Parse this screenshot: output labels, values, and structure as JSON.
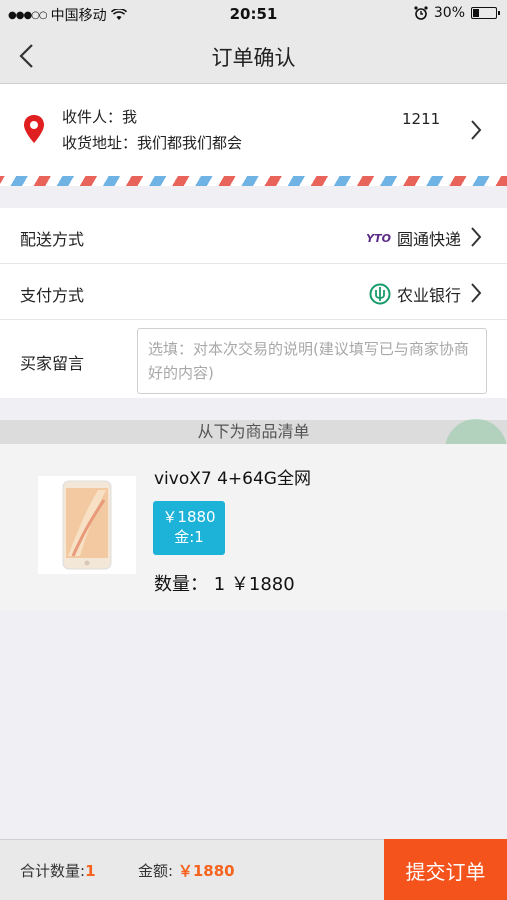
{
  "status": {
    "carrier": "中国移动",
    "time": "20:51",
    "battery": "30%",
    "battery_level": 0.3
  },
  "nav": {
    "title": "订单确认"
  },
  "address": {
    "name_label": "收件人：我",
    "addr_label": "收货地址：我们都我们都会",
    "phone": "1211"
  },
  "shipping": {
    "label": "配送方式",
    "value": "圆通快递",
    "logo_text": "YTO"
  },
  "payment": {
    "label": "支付方式",
    "value": "农业银行"
  },
  "message": {
    "label": "买家留言",
    "placeholder": "选填：对本次交易的说明(建议填写已与商家协商好的内容)"
  },
  "goods_header": "从下为商品清单",
  "product": {
    "name": "vivoX7 4+64G全网",
    "price": "￥1880",
    "gold": "金:1",
    "quantity": "数量：  1    ￥1880"
  },
  "footer": {
    "count_label": "合计数量:",
    "count": "1",
    "amount_label": "金额:",
    "amount": "￥1880",
    "submit": "提交订单"
  },
  "colors": {
    "accent": "#f5531c",
    "badge": "#1db3d8",
    "pin": "#e02020"
  }
}
